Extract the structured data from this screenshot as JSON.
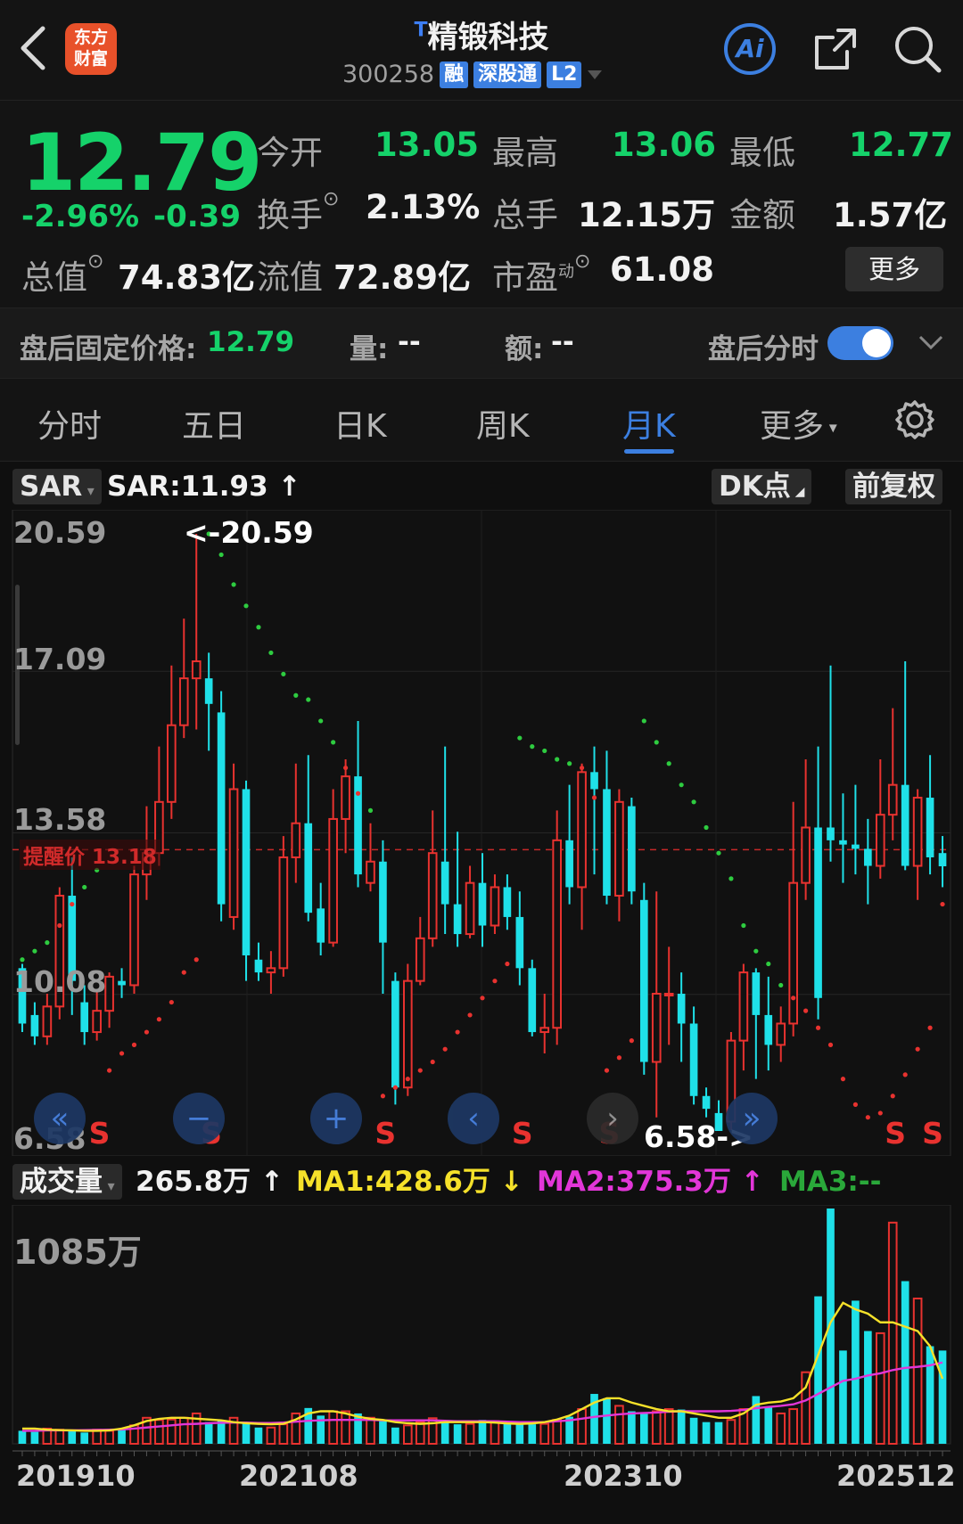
{
  "header": {
    "logo_text_1": "东方",
    "logo_text_2": "财富",
    "title_prefix": "T",
    "title": "精锻科技",
    "code": "300258",
    "tags": [
      "融",
      "深股通",
      "L2"
    ],
    "ai_label": "Ai"
  },
  "quote": {
    "price": "12.79",
    "change_pct": "-2.96%",
    "change": "-0.39",
    "open_label": "今开",
    "open": "13.05",
    "high_label": "最高",
    "high": "13.06",
    "low_label": "最低",
    "low": "12.77",
    "turnover_label": "换手",
    "turnover": "2.13%",
    "volume_label": "总手",
    "volume": "12.15万",
    "amount_label": "金额",
    "amount": "1.57亿",
    "mktcap_label": "总值",
    "mktcap": "74.83亿",
    "float_label": "流值",
    "float": "72.89亿",
    "pe_label": "市盈",
    "pe_sup": "动",
    "pe": "61.08",
    "more_label": "更多"
  },
  "after_hours": {
    "price_label": "盘后固定价格:",
    "price": "12.79",
    "vol_label": "量:",
    "vol": "--",
    "amt_label": "额:",
    "amt": "--",
    "toggle_label": "盘后分时"
  },
  "tabs": [
    "分时",
    "五日",
    "日K",
    "周K",
    "月K",
    "更多"
  ],
  "active_tab": "月K",
  "chart_controls": {
    "indicator": "SAR",
    "indicator_value": "SAR:11.93",
    "dk_label": "DK点",
    "adjust_label": "前复权",
    "high_marker": "<-20.59",
    "low_marker": "6.58->",
    "alert_label": "提醒价 13.18",
    "signal": "S"
  },
  "volume_header": {
    "label": "成交量",
    "value": "265.8万",
    "ma1": "MA1:428.6万",
    "ma2": "MA2:375.3万",
    "ma3": "MA3:--",
    "max_label": "1085万"
  },
  "chart_data": {
    "type": "candlestick",
    "period": "monthly",
    "price_axis_labels": [
      "20.59",
      "17.09",
      "13.58",
      "10.08",
      "6.58"
    ],
    "ylim": [
      6.58,
      20.59
    ],
    "x_labels": [
      "201910",
      "202108",
      "202310",
      "202512"
    ],
    "alert_price": 13.18,
    "colors": {
      "up": "#e8322f",
      "down": "#1fe0e8",
      "sar": "#2ecc40",
      "ma1": "#f5e12a",
      "ma2": "#e236d8"
    },
    "candles": [
      [
        10.4,
        9.1,
        10.5,
        8.9
      ],
      [
        9.3,
        8.8,
        9.6,
        8.6
      ],
      [
        8.8,
        9.5,
        9.8,
        8.6
      ],
      [
        9.5,
        12.1,
        12.3,
        9.2
      ],
      [
        12.1,
        10.1,
        13.0,
        9.3
      ],
      [
        9.6,
        8.9,
        10.0,
        8.6
      ],
      [
        8.9,
        9.4,
        9.9,
        8.7
      ],
      [
        9.4,
        10.2,
        10.3,
        9.0
      ],
      [
        10.1,
        10.0,
        10.4,
        9.7
      ],
      [
        10.0,
        12.6,
        12.8,
        9.8
      ],
      [
        12.6,
        13.1,
        14.2,
        12.0
      ],
      [
        13.1,
        14.3,
        15.6,
        12.8
      ],
      [
        14.3,
        16.1,
        17.5,
        13.9
      ],
      [
        16.1,
        17.2,
        18.6,
        15.8
      ],
      [
        17.2,
        17.6,
        20.59,
        16.0
      ],
      [
        17.2,
        16.6,
        17.8,
        15.5
      ],
      [
        16.4,
        11.9,
        16.9,
        11.5
      ],
      [
        11.6,
        14.6,
        15.2,
        11.3
      ],
      [
        14.6,
        10.7,
        14.8,
        10.1
      ],
      [
        10.6,
        10.3,
        11.0,
        10.1
      ],
      [
        10.3,
        10.4,
        10.8,
        9.8
      ],
      [
        10.4,
        13.0,
        13.5,
        10.2
      ],
      [
        13.0,
        13.8,
        15.2,
        12.4
      ],
      [
        13.8,
        11.7,
        15.4,
        11.5
      ],
      [
        11.8,
        11.0,
        12.4,
        10.7
      ],
      [
        11.0,
        13.9,
        14.6,
        10.9
      ],
      [
        13.9,
        14.9,
        15.3,
        13.1
      ],
      [
        14.9,
        12.6,
        16.2,
        12.3
      ],
      [
        12.4,
        12.9,
        13.8,
        12.2
      ],
      [
        12.9,
        11.0,
        13.4,
        9.8
      ],
      [
        10.1,
        7.6,
        10.3,
        7.2
      ],
      [
        7.6,
        10.1,
        10.5,
        7.4
      ],
      [
        10.1,
        11.1,
        11.6,
        10.0
      ],
      [
        11.1,
        13.1,
        14.1,
        10.9
      ],
      [
        12.9,
        11.9,
        15.6,
        11.2
      ],
      [
        11.9,
        11.2,
        13.6,
        10.9
      ],
      [
        11.2,
        12.4,
        12.8,
        11.1
      ],
      [
        12.4,
        11.4,
        13.1,
        10.9
      ],
      [
        11.4,
        12.3,
        12.6,
        11.2
      ],
      [
        12.3,
        11.6,
        12.6,
        11.3
      ],
      [
        11.6,
        10.4,
        12.2,
        10.0
      ],
      [
        10.4,
        8.9,
        10.6,
        8.8
      ],
      [
        8.9,
        9.0,
        9.8,
        8.4
      ],
      [
        9.0,
        13.4,
        14.1,
        8.6
      ],
      [
        13.4,
        12.3,
        14.7,
        11.9
      ],
      [
        12.3,
        15.0,
        15.2,
        11.3
      ],
      [
        15.0,
        14.6,
        15.6,
        12.6
      ],
      [
        14.6,
        12.1,
        15.5,
        11.9
      ],
      [
        12.1,
        14.3,
        14.6,
        11.5
      ],
      [
        14.2,
        12.2,
        14.4,
        11.9
      ],
      [
        12.0,
        8.2,
        12.4,
        7.9
      ],
      [
        8.2,
        9.8,
        12.2,
        6.9
      ],
      [
        9.8,
        9.8,
        10.9,
        8.6
      ],
      [
        9.8,
        9.1,
        10.3,
        8.2
      ],
      [
        9.1,
        7.4,
        9.5,
        7.2
      ],
      [
        7.4,
        7.1,
        7.6,
        6.9
      ],
      [
        7.0,
        6.58,
        7.3,
        6.58
      ],
      [
        6.8,
        8.7,
        8.9,
        6.6
      ],
      [
        8.7,
        10.3,
        10.5,
        8.0
      ],
      [
        10.3,
        9.3,
        10.4,
        7.8
      ],
      [
        9.3,
        8.6,
        10.2,
        8.0
      ],
      [
        8.6,
        9.1,
        9.5,
        8.2
      ],
      [
        9.1,
        12.4,
        14.3,
        8.8
      ],
      [
        12.4,
        13.7,
        15.3,
        12.0
      ],
      [
        13.7,
        9.7,
        15.6,
        9.2
      ],
      [
        13.7,
        13.4,
        17.5,
        12.9
      ],
      [
        13.4,
        13.3,
        14.5,
        12.4
      ],
      [
        13.3,
        13.2,
        14.7,
        12.6
      ],
      [
        13.2,
        12.8,
        13.9,
        11.9
      ],
      [
        12.8,
        14.0,
        15.3,
        12.5
      ],
      [
        14.0,
        14.7,
        16.5,
        13.4
      ],
      [
        14.7,
        12.8,
        17.6,
        12.7
      ],
      [
        12.8,
        14.4,
        14.6,
        12.0
      ],
      [
        14.4,
        13.0,
        15.4,
        12.6
      ],
      [
        13.1,
        12.79,
        13.5,
        12.3
      ]
    ],
    "volume": [
      60,
      55,
      70,
      65,
      62,
      52,
      65,
      60,
      70,
      85,
      120,
      110,
      112,
      120,
      140,
      100,
      110,
      120,
      95,
      75,
      75,
      90,
      140,
      165,
      130,
      150,
      150,
      140,
      120,
      110,
      75,
      85,
      100,
      118,
      100,
      90,
      92,
      110,
      104,
      96,
      92,
      90,
      92,
      110,
      125,
      160,
      230,
      210,
      175,
      150,
      140,
      150,
      160,
      158,
      120,
      100,
      100,
      110,
      160,
      220,
      170,
      140,
      160,
      330,
      680,
      1085,
      430,
      660,
      520,
      510,
      1020,
      750,
      670,
      450,
      430
    ],
    "sar": [
      10.6,
      10.8,
      11.0,
      11.4,
      11.9,
      12.3,
      12.7,
      8.0,
      8.4,
      8.6,
      8.9,
      9.2,
      9.6,
      10.3,
      10.6,
      20.59,
      20.1,
      19.4,
      18.9,
      18.4,
      17.8,
      17.3,
      16.8,
      16.7,
      16.2,
      15.7,
      15.1,
      14.5,
      14.1,
      7.4,
      7.6,
      7.8,
      8.0,
      8.2,
      8.5,
      8.9,
      9.3,
      9.7,
      10.1,
      10.5,
      15.8,
      15.6,
      15.5,
      15.3,
      15.2,
      15.1,
      14.4,
      8.0,
      8.3,
      8.7,
      16.2,
      15.7,
      15.2,
      14.7,
      14.3,
      13.7,
      13.1,
      12.5,
      11.4,
      10.8,
      10.5,
      10.0,
      9.7,
      9.4,
      9.0,
      8.6,
      7.8,
      7.2,
      6.9,
      7.0,
      7.4,
      7.9,
      8.5,
      9.0,
      11.9
    ],
    "ma1": [
      70,
      70,
      65,
      63,
      62,
      60,
      60,
      62,
      70,
      85,
      105,
      115,
      120,
      120,
      116,
      112,
      108,
      100,
      95,
      92,
      90,
      92,
      112,
      140,
      150,
      150,
      140,
      125,
      115,
      110,
      100,
      95,
      92,
      95,
      100,
      100,
      100,
      100,
      98,
      94,
      92,
      94,
      100,
      112,
      130,
      160,
      190,
      210,
      210,
      190,
      175,
      160,
      150,
      150,
      140,
      130,
      120,
      120,
      140,
      180,
      190,
      195,
      210,
      260,
      410,
      560,
      650,
      620,
      600,
      560,
      560,
      540,
      520,
      450,
      300
    ],
    "ma2": [
      60,
      60,
      62,
      62,
      62,
      63,
      64,
      65,
      66,
      70,
      75,
      80,
      85,
      90,
      92,
      95,
      97,
      98,
      98,
      96,
      96,
      98,
      102,
      106,
      108,
      110,
      110,
      110,
      110,
      108,
      108,
      108,
      108,
      108,
      106,
      104,
      104,
      104,
      104,
      102,
      100,
      100,
      100,
      104,
      108,
      116,
      124,
      130,
      136,
      140,
      142,
      144,
      148,
      150,
      150,
      150,
      150,
      152,
      156,
      164,
      170,
      175,
      182,
      200,
      230,
      260,
      290,
      300,
      315,
      325,
      340,
      350,
      355,
      362,
      375
    ]
  }
}
